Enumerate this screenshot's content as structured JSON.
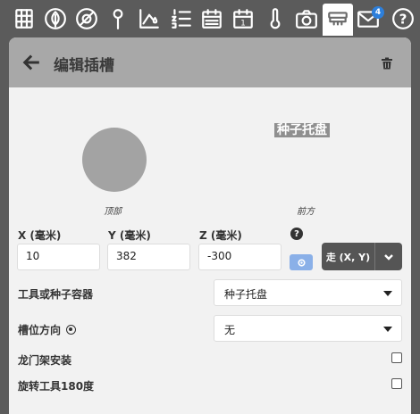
{
  "nav": {
    "icons": [
      "grid-icon",
      "leaf-icon",
      "no-plant-icon",
      "pin-icon",
      "chart-drop-icon",
      "numbered-list-icon",
      "calendar-icon",
      "calendar-day-icon",
      "thermometer-icon",
      "camera-icon",
      "tool-slots-icon",
      "mail-icon",
      "help-icon"
    ],
    "calendar_day": "1",
    "mail_badge": "4",
    "help_glyph": "?"
  },
  "panel": {
    "title": "编辑插槽",
    "top_view_label": "顶部",
    "front_view_label": "前方",
    "front_slot_text": "种子托盘"
  },
  "coordinates": {
    "x_label": "X (毫米)",
    "y_label": "Y (毫米)",
    "z_label": "Z (毫米)",
    "x_value": "10",
    "y_value": "382",
    "z_value": "-300",
    "help_glyph": "?",
    "go_label": "走 (X, Y)"
  },
  "form": {
    "tool_label": "工具或种子容器",
    "tool_value": "种子托盘",
    "direction_label": "槽位方向",
    "direction_value": "无",
    "gantry_label": "龙门架安装",
    "rotate_label": "旋转工具180度"
  },
  "colors": {
    "background": "#5b5b5b",
    "panel": "#f2f2f2",
    "header": "#a8a8a8",
    "accent_blue": "#2d7fdb",
    "go_button": "#555555"
  }
}
